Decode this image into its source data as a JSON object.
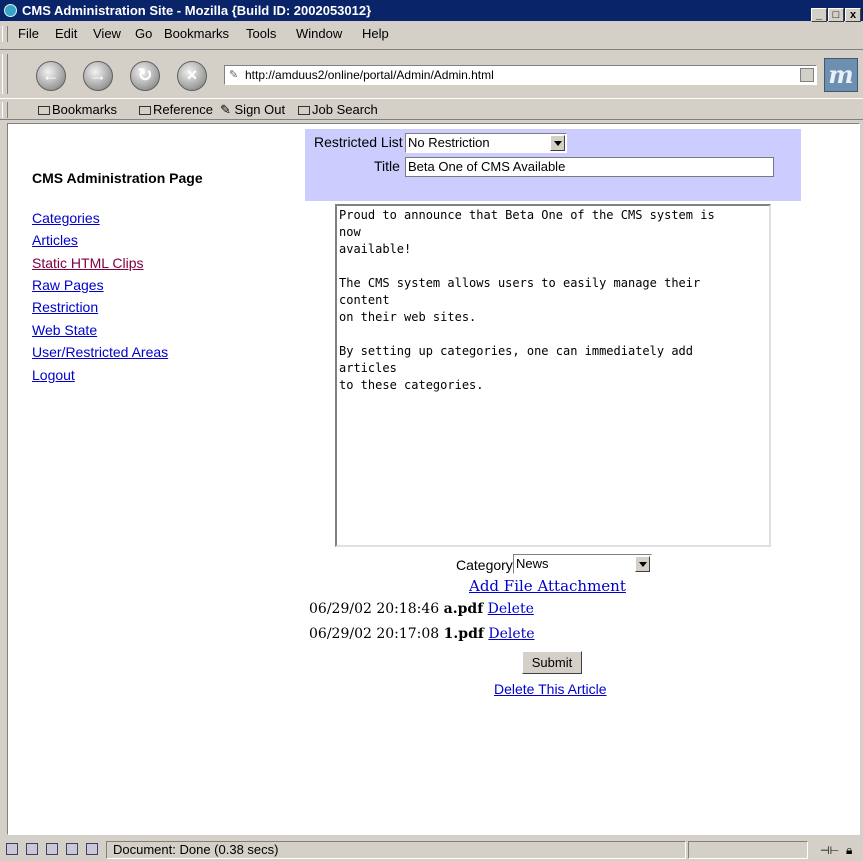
{
  "window": {
    "title": "CMS Administration Site - Mozilla {Build ID: 2002053012}",
    "minimize": "_",
    "maximize": "□",
    "close": "x"
  },
  "menu": {
    "items": [
      "File",
      "Edit",
      "View",
      "Go",
      "Bookmarks",
      "Tools",
      "Window",
      "Help"
    ]
  },
  "nav": {
    "url": "http://amduus2/online/portal/Admin/Admin.html",
    "logo": "m"
  },
  "bookmarks": {
    "items": [
      "Bookmarks",
      "Reference",
      "Sign Out",
      "Job Search"
    ]
  },
  "sidebar": {
    "heading": "CMS Administration Page",
    "links": [
      "Categories",
      "Articles",
      "Static HTML Clips",
      "Raw Pages",
      "Restriction",
      "Web State",
      "User/Restricted Areas",
      "Logout"
    ]
  },
  "form": {
    "restricted_label": "Restricted List",
    "restricted_value": "No Restriction",
    "title_label": "Title",
    "title_value": "Beta One of CMS Available",
    "body": "Proud to announce that Beta One of the CMS system is\nnow\navailable!\n\nThe CMS system allows users to easily manage their\ncontent\non their web sites.\n\nBy setting up categories, one can immediately add\narticles\nto these categories.",
    "category_label": "Category",
    "category_value": "News",
    "add_attachment": "Add File Attachment",
    "attachments": [
      {
        "timestamp": "06/29/02 20:18:46",
        "file": "a.pdf",
        "delete": "Delete"
      },
      {
        "timestamp": "06/29/02 20:17:08",
        "file": "1.pdf",
        "delete": "Delete"
      }
    ],
    "submit": "Submit",
    "delete_article": "Delete This Article"
  },
  "status": {
    "text": "Document: Done (0.38 secs)"
  }
}
